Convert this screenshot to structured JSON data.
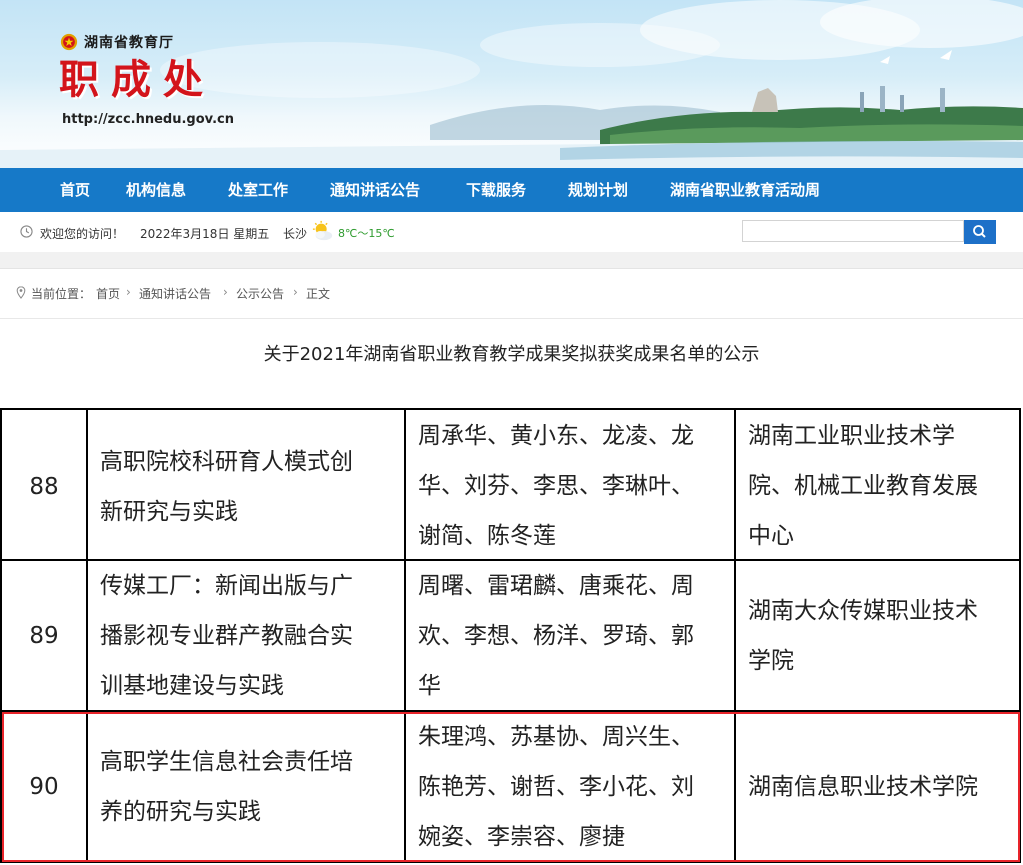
{
  "header": {
    "agency": "湖南省教育厅",
    "site_title": "职成处",
    "url": "http://zcc.hnedu.gov.cn"
  },
  "nav": {
    "items": [
      {
        "label": "首页"
      },
      {
        "label": "机构信息"
      },
      {
        "label": "处室工作"
      },
      {
        "label": "通知讲话公告"
      },
      {
        "label": "下载服务"
      },
      {
        "label": "规划计划"
      },
      {
        "label": "湖南省职业教育活动周"
      }
    ]
  },
  "infobar": {
    "welcome": "欢迎您的访问！",
    "date": "2022年3月18日 星期五",
    "city": "长沙",
    "temperature": "8℃～15℃",
    "weather_icon": "sun-cloud-icon",
    "search_placeholder": ""
  },
  "breadcrumb": {
    "prefix": "当前位置：",
    "items": [
      "首页",
      "通知讲话公告",
      "公示公告",
      "正文"
    ]
  },
  "article": {
    "title": "关于2021年湖南省职业教育教学成果奖拟获奖成果名单的公示"
  },
  "table": {
    "rows": [
      {
        "num": "88",
        "title": [
          "高职院校科研育人模式创",
          "新研究与实践"
        ],
        "authors": [
          "周承华、黄小东、龙凌、龙",
          "华、刘芬、李思、李琳叶、",
          "谢简、陈冬莲"
        ],
        "org": [
          "湖南工业职业技术学",
          "院、机械工业教育发展",
          "中心"
        ]
      },
      {
        "num": "89",
        "title": [
          "传媒工厂：新闻出版与广",
          "播影视专业群产教融合实",
          "训基地建设与实践"
        ],
        "authors": [
          "周曙、雷珺麟、唐乘花、周",
          "欢、李想、杨洋、罗琦、郭",
          "华"
        ],
        "org": [
          "湖南大众传媒职业技术",
          "学院"
        ]
      },
      {
        "num": "90",
        "title": [
          "高职学生信息社会责任培",
          "养的研究与实践"
        ],
        "authors": [
          "朱理鸿、苏基协、周兴生、",
          "陈艳芳、谢哲、李小花、刘",
          "婉姿、李崇容、廖捷"
        ],
        "org": [
          "湖南信息职业技术学院"
        ]
      }
    ]
  },
  "colors": {
    "nav_bg": "#1679c8",
    "title_red": "#d3141b",
    "highlight": "#e8242a",
    "temperature": "#2e9b2e"
  }
}
